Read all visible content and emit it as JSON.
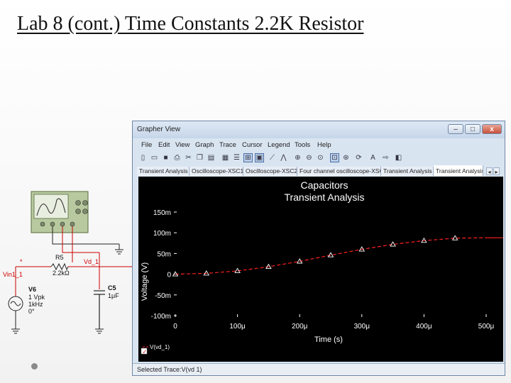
{
  "slide": {
    "title": "Lab 8 (cont.) Time Constants 2.2K Resistor"
  },
  "schematic": {
    "resistor_name": "R5",
    "resistor_value": "2.2kΩ",
    "net_in": "Vin1_1",
    "net_out": "Vd_1",
    "node_marker": "*",
    "source_name": "V6",
    "source_amplitude": "1 Vpk",
    "source_frequency": "1kHz",
    "source_phase": "0°",
    "capacitor_name": "C5",
    "capacitor_value": "1μF"
  },
  "grapher": {
    "title": "Grapher View",
    "menu": [
      "File",
      "Edit",
      "View",
      "Graph",
      "Trace",
      "Cursor",
      "Legend",
      "Tools",
      "Help"
    ],
    "tabs": [
      "Transient Analysis",
      "Oscilloscope-XSC1",
      "Oscilloscope-XSC2",
      "Four channel oscilloscope-XSC3",
      "Transient Analysis",
      "Transient Analysis"
    ],
    "active_tab": 5,
    "status": "Selected Trace:V(vd 1)",
    "window_buttons": {
      "minimize": "–",
      "maximize": "□",
      "close": "x"
    },
    "toolbar_icons": [
      "new-icon",
      "open-icon",
      "save-icon",
      "print-icon",
      "cut-icon",
      "copy-icon",
      "paste-icon",
      "grid-icon",
      "legend-icon",
      "cursor-icon",
      "zoom-icon",
      "trace-icon",
      "overlay-icon",
      "zoom-in-icon",
      "zoom-out-icon",
      "zoom-area-icon",
      "zoom-x-icon",
      "zoom-y-icon",
      "fit-icon",
      "text-icon",
      "export-icon",
      "bw-icon"
    ]
  },
  "chart_data": {
    "type": "line",
    "title": "Capacitors",
    "subtitle": "Transient Analysis",
    "xlabel": "Time (s)",
    "ylabel": "Voltage (V)",
    "xlim": [
      0,
      0.0005
    ],
    "ylim": [
      -0.1,
      0.15
    ],
    "x_ticks": [
      0,
      0.0001,
      0.0002,
      0.0003,
      0.0004,
      0.0005
    ],
    "x_tick_labels": [
      "0",
      "100μ",
      "200μ",
      "300μ",
      "400μ",
      "500μ"
    ],
    "y_ticks": [
      -0.1,
      -0.05,
      0,
      0.05,
      0.1,
      0.15
    ],
    "y_tick_labels": [
      "-100m",
      "-50m",
      "0",
      "50m",
      "100m",
      "150m"
    ],
    "grid": false,
    "background": "#000000",
    "series": [
      {
        "name": "V(vd_1)",
        "color": "#ff2020",
        "x": [
          0,
          5e-05,
          0.0001,
          0.00015,
          0.0002,
          0.00025,
          0.0003,
          0.00035,
          0.0004,
          0.00045,
          0.0005
        ],
        "y": [
          0,
          0.002,
          0.008,
          0.018,
          0.031,
          0.046,
          0.06,
          0.072,
          0.081,
          0.087,
          0.088
        ],
        "marker": "triangle",
        "marker_x": [
          0,
          5e-05,
          0.0001,
          0.00015,
          0.0002,
          0.00025,
          0.0003,
          0.00035,
          0.0004,
          0.00045
        ],
        "marker_y": [
          0,
          0.002,
          0.008,
          0.018,
          0.031,
          0.046,
          0.06,
          0.072,
          0.081,
          0.087
        ]
      }
    ],
    "legend": {
      "placement": "bottom-left",
      "entry": "V(vd_1)",
      "checked": true
    }
  }
}
